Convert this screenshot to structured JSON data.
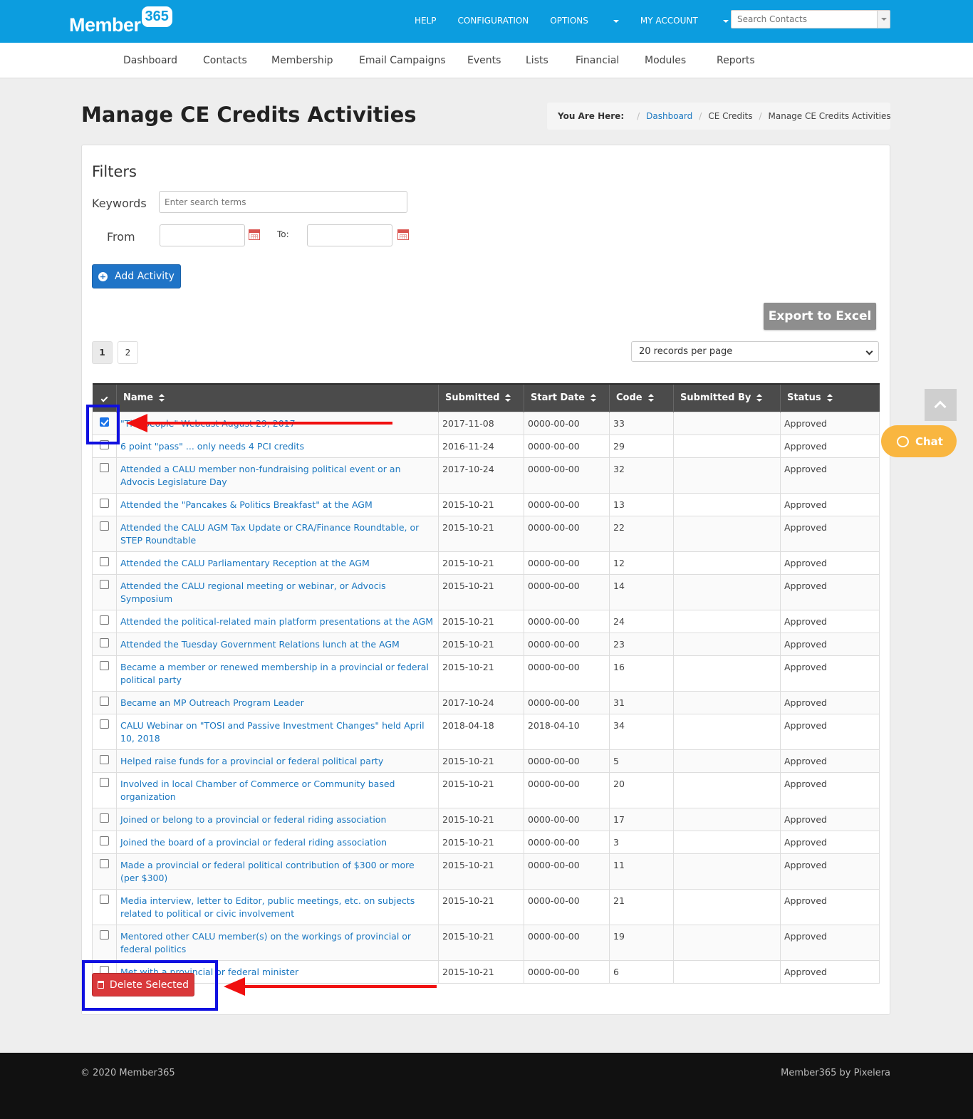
{
  "brand": {
    "word": "Member",
    "number": "365"
  },
  "topnav": {
    "help": "HELP",
    "configuration": "CONFIGURATION",
    "options": "OPTIONS",
    "my_account": "MY ACCOUNT"
  },
  "search": {
    "placeholder": "Search Contacts"
  },
  "mainnav": [
    "Dashboard",
    "Contacts",
    "Membership",
    "Email Campaigns",
    "Events",
    "Lists",
    "Financial",
    "Modules",
    "Reports"
  ],
  "page": {
    "title": "Manage CE Credits Activities"
  },
  "breadcrumb": {
    "label": "You Are Here:",
    "items": [
      "Dashboard",
      "CE Credits",
      "Manage CE Credits Activities"
    ]
  },
  "filters": {
    "heading": "Filters",
    "keywords_label": "Keywords",
    "keywords_placeholder": "Enter search terms",
    "from_label": "From",
    "to_label": "To:"
  },
  "buttons": {
    "add_activity": "Add Activity",
    "export_excel": "Export to Excel",
    "delete_selected": "Delete Selected"
  },
  "pagination": {
    "pages": [
      "1",
      "2"
    ],
    "current": "1",
    "per_page": "20 records per page"
  },
  "table": {
    "columns": [
      "Name",
      "Submitted",
      "Start Date",
      "Code",
      "Submitted By",
      "Status"
    ],
    "rows": [
      {
        "checked": true,
        "name": "\"The people\" Webcast August 29, 2017",
        "submitted": "2017-11-08",
        "start": "0000-00-00",
        "code": "33",
        "by": "",
        "status": "Approved"
      },
      {
        "checked": false,
        "name": "6 point \"pass\" ... only needs 4 PCI credits",
        "submitted": "2016-11-24",
        "start": "0000-00-00",
        "code": "29",
        "by": "",
        "status": "Approved"
      },
      {
        "checked": false,
        "name": "Attended a CALU member non-fundraising political event or an Advocis Legislature Day",
        "submitted": "2017-10-24",
        "start": "0000-00-00",
        "code": "32",
        "by": "",
        "status": "Approved"
      },
      {
        "checked": false,
        "name": "Attended the \"Pancakes & Politics Breakfast\" at the AGM",
        "submitted": "2015-10-21",
        "start": "0000-00-00",
        "code": "13",
        "by": "",
        "status": "Approved"
      },
      {
        "checked": false,
        "name": "Attended the CALU AGM Tax Update or CRA/Finance Roundtable, or STEP Roundtable",
        "submitted": "2015-10-21",
        "start": "0000-00-00",
        "code": "22",
        "by": "",
        "status": "Approved"
      },
      {
        "checked": false,
        "name": "Attended the CALU Parliamentary Reception at the AGM",
        "submitted": "2015-10-21",
        "start": "0000-00-00",
        "code": "12",
        "by": "",
        "status": "Approved"
      },
      {
        "checked": false,
        "name": "Attended the CALU regional meeting or webinar, or Advocis Symposium",
        "submitted": "2015-10-21",
        "start": "0000-00-00",
        "code": "14",
        "by": "",
        "status": "Approved"
      },
      {
        "checked": false,
        "name": "Attended the political-related main platform presentations at the AGM",
        "submitted": "2015-10-21",
        "start": "0000-00-00",
        "code": "24",
        "by": "",
        "status": "Approved"
      },
      {
        "checked": false,
        "name": "Attended the Tuesday Government Relations lunch at the AGM",
        "submitted": "2015-10-21",
        "start": "0000-00-00",
        "code": "23",
        "by": "",
        "status": "Approved"
      },
      {
        "checked": false,
        "name": "Became a member or renewed membership in a provincial or federal political party",
        "submitted": "2015-10-21",
        "start": "0000-00-00",
        "code": "16",
        "by": "",
        "status": "Approved"
      },
      {
        "checked": false,
        "name": "Became an MP Outreach Program Leader",
        "submitted": "2017-10-24",
        "start": "0000-00-00",
        "code": "31",
        "by": "",
        "status": "Approved"
      },
      {
        "checked": false,
        "name": "CALU Webinar on \"TOSI and Passive Investment Changes\" held April 10, 2018",
        "submitted": "2018-04-18",
        "start": "2018-04-10",
        "code": "34",
        "by": "",
        "status": "Approved"
      },
      {
        "checked": false,
        "name": "Helped raise funds for a provincial or federal political party",
        "submitted": "2015-10-21",
        "start": "0000-00-00",
        "code": "5",
        "by": "",
        "status": "Approved"
      },
      {
        "checked": false,
        "name": "Involved in local Chamber of Commerce or Community based organization",
        "submitted": "2015-10-21",
        "start": "0000-00-00",
        "code": "20",
        "by": "",
        "status": "Approved"
      },
      {
        "checked": false,
        "name": "Joined or belong to a provincial or federal riding association",
        "submitted": "2015-10-21",
        "start": "0000-00-00",
        "code": "17",
        "by": "",
        "status": "Approved"
      },
      {
        "checked": false,
        "name": "Joined the board of a provincial or federal riding association",
        "submitted": "2015-10-21",
        "start": "0000-00-00",
        "code": "3",
        "by": "",
        "status": "Approved"
      },
      {
        "checked": false,
        "name": "Made a provincial or federal political contribution of $300 or more (per $300)",
        "submitted": "2015-10-21",
        "start": "0000-00-00",
        "code": "11",
        "by": "",
        "status": "Approved"
      },
      {
        "checked": false,
        "name": "Media interview, letter to Editor, public meetings, etc. on subjects related to political or civic involvement",
        "submitted": "2015-10-21",
        "start": "0000-00-00",
        "code": "21",
        "by": "",
        "status": "Approved"
      },
      {
        "checked": false,
        "name": "Mentored other CALU member(s) on the workings of provincial or federal politics",
        "submitted": "2015-10-21",
        "start": "0000-00-00",
        "code": "19",
        "by": "",
        "status": "Approved"
      },
      {
        "checked": false,
        "name": "Met with a provincial or federal minister",
        "submitted": "2015-10-21",
        "start": "0000-00-00",
        "code": "6",
        "by": "",
        "status": "Approved"
      }
    ]
  },
  "chat": {
    "label": "Chat"
  },
  "footer": {
    "left": "© 2020 Member365",
    "right": "Member365 by Pixelera"
  },
  "colors": {
    "topbar": "#0c9ddf",
    "link": "#1a77c0",
    "add_button": "#1f74c7",
    "delete_button": "#d9383a",
    "annotation_box": "#1010e0",
    "annotation_arrow": "#f01010",
    "chat": "#f9b640"
  }
}
